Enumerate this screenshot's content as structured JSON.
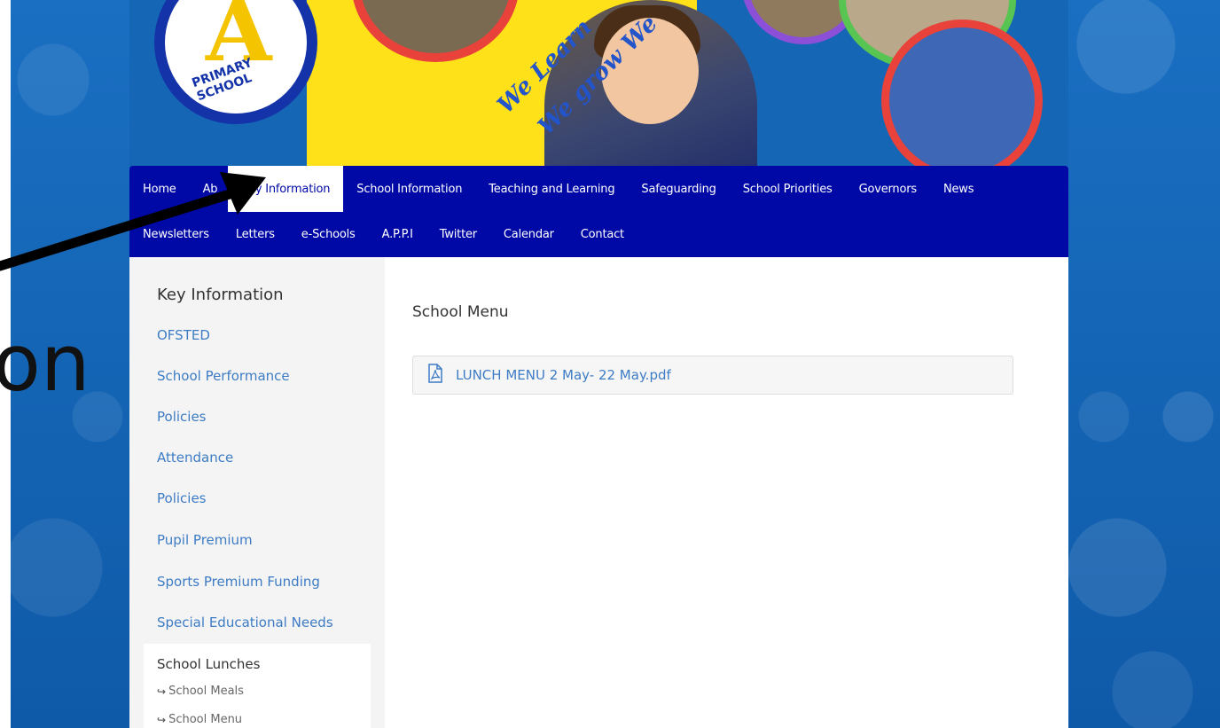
{
  "header": {
    "logo_letter": "A",
    "logo_text": "PRIMARY SCHOOL",
    "tagline_1": "We Learn",
    "tagline_2": "We grow We"
  },
  "nav": {
    "row1": [
      "Home",
      "Ab",
      "Key Information",
      "School Information",
      "Teaching and Learning",
      "Safeguarding",
      "School Priorities",
      "Governors",
      "News"
    ],
    "row2": [
      "Newsletters",
      "Letters",
      "e-Schools",
      "A.P.P.I",
      "Twitter",
      "Calendar",
      "Contact"
    ],
    "active": "Key Information"
  },
  "sidebar": {
    "title": "Key Information",
    "links": [
      "OFSTED",
      "School Performance",
      "Policies",
      "Attendance",
      "Policies",
      "Pupil Premium",
      "Sports Premium Funding",
      "Special Educational Needs"
    ],
    "active_section": {
      "label": "School Lunches",
      "subitems": [
        "School Meals",
        "School Menu"
      ]
    }
  },
  "main": {
    "title": "School Menu",
    "file_name": "LUNCH MENU 2 May- 22 May.pdf",
    "file_icon": "pdf-file-icon"
  },
  "annotation": {
    "cut_text": "on"
  },
  "colors": {
    "nav_bg": "#0008a6",
    "page_bg": "#1566b5",
    "link": "#3d7cc5",
    "sidebar_bg": "#f4f4f4"
  }
}
